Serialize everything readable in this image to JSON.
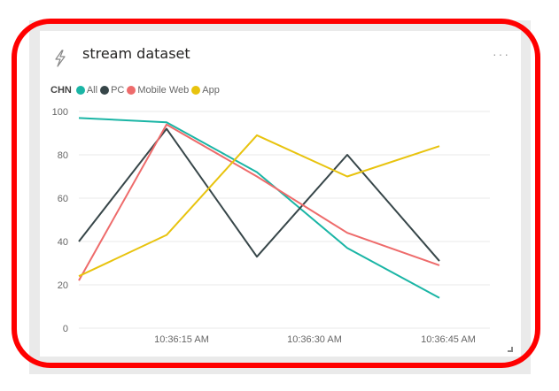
{
  "tile": {
    "title": "stream dataset",
    "menu_label": "···",
    "icon": "lightning-bolt-icon"
  },
  "legend": {
    "title": "CHN",
    "items": [
      {
        "label": "All",
        "color": "#1ab5a5"
      },
      {
        "label": "PC",
        "color": "#374649"
      },
      {
        "label": "Mobile Web",
        "color": "#ee6b6b"
      },
      {
        "label": "App",
        "color": "#e8c30e"
      }
    ]
  },
  "chart_data": {
    "type": "line",
    "x_tick_labels": [
      "10:36:15 AM",
      "10:36:30 AM",
      "10:36:45 AM"
    ],
    "y_ticks": [
      0,
      20,
      40,
      60,
      80,
      100
    ],
    "ylim": [
      0,
      100
    ],
    "grid": true,
    "legend_position": "top-left",
    "series": [
      {
        "name": "All",
        "color": "#1ab5a5",
        "points": [
          [
            0,
            97
          ],
          [
            10,
            95
          ],
          [
            20,
            72
          ],
          [
            30,
            37
          ],
          [
            40,
            14
          ]
        ]
      },
      {
        "name": "PC",
        "color": "#374649",
        "points": [
          [
            0,
            40
          ],
          [
            10,
            92
          ],
          [
            20,
            33
          ],
          [
            30,
            80
          ],
          [
            40,
            31
          ]
        ]
      },
      {
        "name": "Mobile Web",
        "color": "#ee6b6b",
        "points": [
          [
            0,
            22
          ],
          [
            10,
            94
          ],
          [
            20,
            70
          ],
          [
            30,
            44
          ],
          [
            40,
            29
          ]
        ]
      },
      {
        "name": "App",
        "color": "#e8c30e",
        "points": [
          [
            0,
            24
          ],
          [
            10,
            43
          ],
          [
            20,
            89
          ],
          [
            30,
            70
          ],
          [
            40,
            84
          ]
        ]
      }
    ],
    "x_tick_positions": [
      10,
      20,
      30,
      40
    ],
    "x_range": [
      0,
      40
    ]
  }
}
